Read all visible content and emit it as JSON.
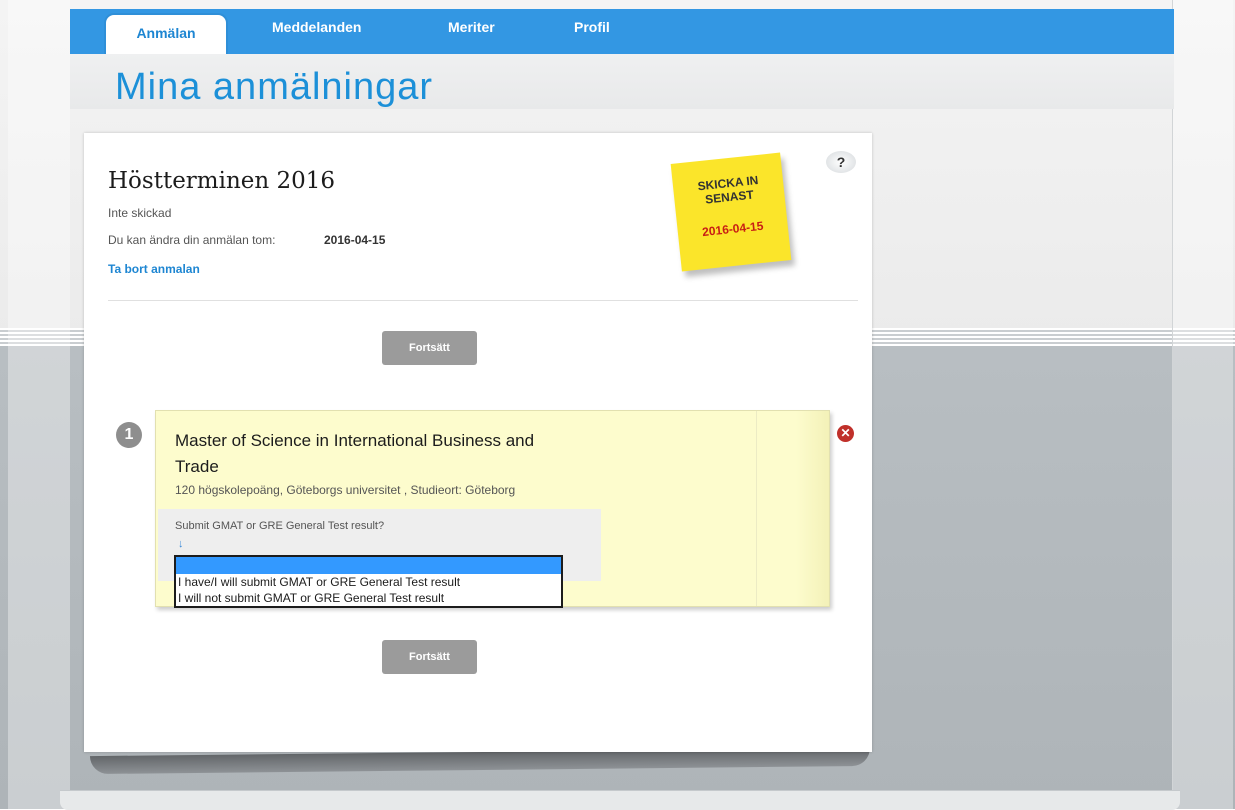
{
  "nav": {
    "tabs": [
      {
        "label": "Anmälan"
      },
      {
        "label": "Meddelanden"
      },
      {
        "label": "Meriter"
      },
      {
        "label": "Profil"
      }
    ]
  },
  "page": {
    "title": "Mina anmälningar"
  },
  "application": {
    "term": "Höstterminen 2016",
    "status": "Inte skickad",
    "deadline_text": "Du kan ändra din anmälan tom:",
    "deadline_date": "2016-04-15",
    "remove_link": "Ta bort anmalan",
    "help_label": "?"
  },
  "sticky": {
    "line1": "SKICKA IN",
    "line2": "SENAST",
    "date": "2016-04-15"
  },
  "buttons": {
    "continue_top": "Fortsätt",
    "continue_bottom": "Fortsätt"
  },
  "course": {
    "rank": "1",
    "title": "Master of Science in International Business and Trade",
    "meta": "120 högskolepoäng, Göteborgs universitet , Studieort: Göteborg",
    "question": "Submit GMAT or GRE General Test result?",
    "dropdown_options": [
      "I have/I will submit GMAT or GRE General Test result",
      "I will not submit GMAT or GRE General Test result"
    ]
  },
  "colors": {
    "brand_blue": "#3397e3",
    "sticky_yellow": "#fbe52a",
    "course_bg": "#fdfccd"
  }
}
